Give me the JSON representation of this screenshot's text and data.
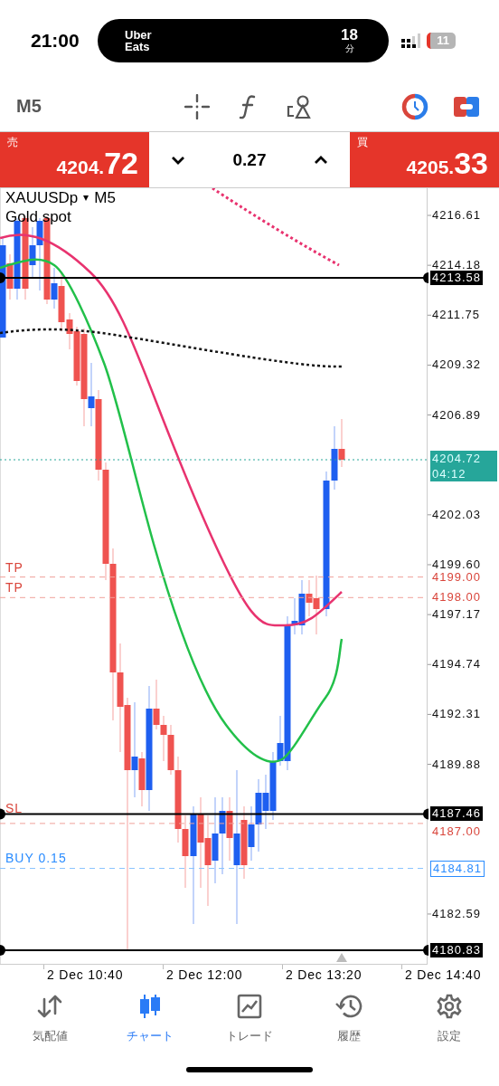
{
  "status_bar": {
    "time": "21:00",
    "live_activity": {
      "app_lines": [
        "Uber",
        "Eats"
      ],
      "minutes": "18",
      "unit": "分"
    },
    "battery": "11"
  },
  "toolbar": {
    "timeframe": "M5"
  },
  "quote": {
    "sell": {
      "label": "売",
      "price_head": "4204.",
      "price_tail": "72"
    },
    "spread": "0.27",
    "buy": {
      "label": "買",
      "price_head": "4205.",
      "price_tail": "33"
    }
  },
  "chart": {
    "symbol": "XAUUSDp",
    "symbol_arrow": "▾",
    "timeframe": "M5",
    "description": "Gold spot",
    "price_ticks": [
      "4216.61",
      "4214.18",
      "4211.75",
      "4209.32",
      "4206.89",
      "4202.03",
      "4199.60",
      "4197.17",
      "4194.74",
      "4192.31",
      "4189.88",
      "4182.59"
    ],
    "lines": [
      {
        "kind": "level",
        "price": "4213.58"
      },
      {
        "kind": "current",
        "price": "4204.72",
        "countdown": "04:12"
      },
      {
        "kind": "take_profit",
        "label": "TP",
        "price": "4199.00"
      },
      {
        "kind": "take_profit",
        "label": "TP",
        "price": "4198.00"
      },
      {
        "kind": "level",
        "price": "4187.46"
      },
      {
        "kind": "stop_loss",
        "label": "SL",
        "price": "4187.00"
      },
      {
        "kind": "order",
        "label": "BUY 0.15",
        "price": "4184.81"
      },
      {
        "kind": "level",
        "price": "4180.83"
      }
    ],
    "time_ticks": [
      "2 Dec 10:40",
      "2 Dec 12:00",
      "2 Dec 13:20",
      "2 Dec 14:40"
    ]
  },
  "tab_bar": {
    "tabs": [
      {
        "label": "気配値",
        "selected": false
      },
      {
        "label": "チャート",
        "selected": true
      },
      {
        "label": "トレード",
        "selected": false
      },
      {
        "label": "履歴",
        "selected": false
      },
      {
        "label": "設定",
        "selected": false
      }
    ]
  }
}
